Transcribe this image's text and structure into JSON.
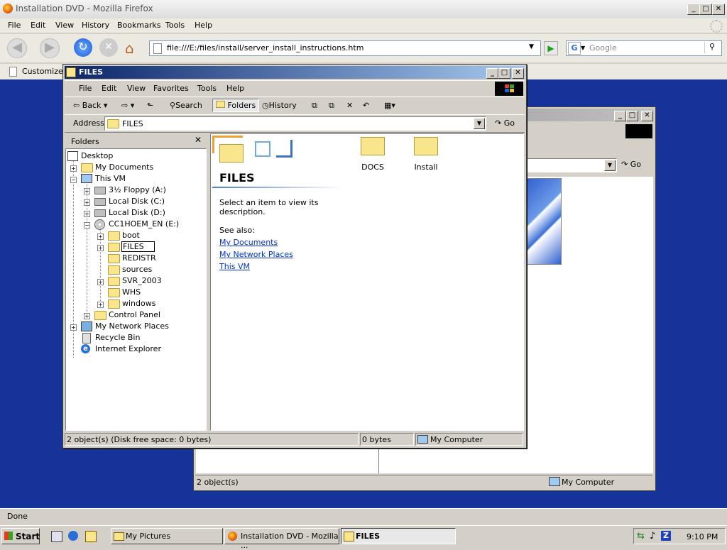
{
  "firefox": {
    "title": "Installation DVD - Mozilla Firefox",
    "menu": [
      "File",
      "Edit",
      "View",
      "History",
      "Bookmarks",
      "Tools",
      "Help"
    ],
    "url": "file:///E:/files/install/server_install_instructions.htm",
    "search_placeholder": "Google",
    "bookmark": "Customize L",
    "status": "Done"
  },
  "back_window": {
    "go_label": "Go",
    "status_left": "2 object(s)",
    "status_right": "My Computer"
  },
  "explorer": {
    "title": "FILES",
    "menu": [
      "File",
      "Edit",
      "View",
      "Favorites",
      "Tools",
      "Help"
    ],
    "toolbar": {
      "back": "Back",
      "search": "Search",
      "folders": "Folders",
      "history": "History"
    },
    "address_label": "Address",
    "address_value": "FILES",
    "go_label": "Go",
    "folders_pane_title": "Folders",
    "tree": {
      "desktop": "Desktop",
      "my_documents": "My Documents",
      "this_vm": "This VM",
      "floppy": "3½ Floppy (A:)",
      "local_c": "Local Disk (C:)",
      "local_d": "Local Disk (D:)",
      "dvd": "CC1HOEM_EN (E:)",
      "boot": "boot",
      "files": "FILES",
      "redistr": "REDISTR",
      "sources": "sources",
      "svr": "SVR_2003",
      "whs": "WHS",
      "windows": "windows",
      "control_panel": "Control Panel",
      "network": "My Network Places",
      "recycle": "Recycle Bin",
      "ie": "Internet Explorer"
    },
    "folder_heading": "FILES",
    "description": "Select an item to view its description.",
    "see_also": "See also:",
    "links": [
      "My Documents",
      "My Network Places",
      "This VM"
    ],
    "items": [
      "DOCS",
      "Install"
    ],
    "status_left": "2 object(s) (Disk free space: 0 bytes)",
    "status_mid": "0 bytes",
    "status_right": "My Computer"
  },
  "taskbar": {
    "start": "Start",
    "tasks": [
      "My Pictures",
      "Installation DVD - Mozilla ...",
      "FILES"
    ],
    "clock": "9:10 PM"
  },
  "colors": {
    "desktop_blue": "#16339a",
    "title_active": "#0a246a",
    "link": "#0033cc"
  }
}
